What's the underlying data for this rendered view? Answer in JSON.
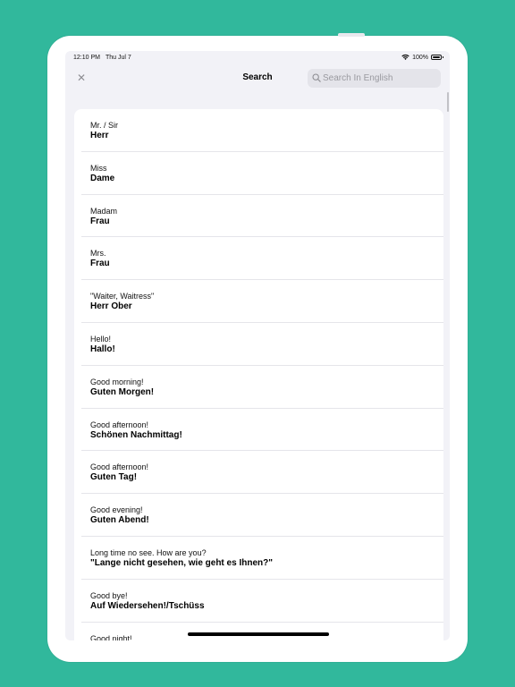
{
  "status_bar": {
    "time": "12:10 PM",
    "date": "Thu Jul 7",
    "battery": "100%"
  },
  "nav": {
    "title": "Search",
    "close_icon": "close-icon",
    "close_glyph": "✕"
  },
  "search": {
    "placeholder": "Search In English",
    "value": ""
  },
  "colors": {
    "background": "#31b89c",
    "screen": "#f2f2f7",
    "card": "#ffffff"
  },
  "phrases": [
    {
      "english": "Mr. / Sir",
      "german": "Herr"
    },
    {
      "english": "Miss",
      "german": "Dame"
    },
    {
      "english": "Madam",
      "german": "Frau"
    },
    {
      "english": "Mrs.",
      "german": "Frau"
    },
    {
      "english": "\"Waiter, Waitress\"",
      "german": "Herr Ober"
    },
    {
      "english": "Hello!",
      "german": "Hallo!"
    },
    {
      "english": "Good morning!",
      "german": "Guten Morgen!"
    },
    {
      "english": "Good afternoon!",
      "german": "Schönen Nachmittag!"
    },
    {
      "english": "Good afternoon!",
      "german": "Guten Tag!"
    },
    {
      "english": "Good evening!",
      "german": "Guten Abend!"
    },
    {
      "english": "Long time no see. How are you?",
      "german": "\"Lange nicht gesehen, wie geht es Ihnen?\""
    },
    {
      "english": "Good bye!",
      "german": "Auf Wiedersehen!/Tschüss"
    },
    {
      "english": "Good night!",
      "german": ""
    }
  ]
}
